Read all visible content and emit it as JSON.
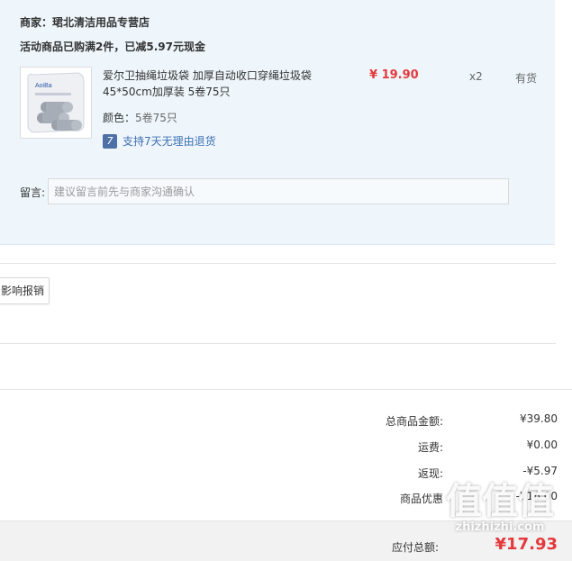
{
  "store": {
    "prefix": "商家：",
    "name": "珺北清洁用品专营店",
    "promotion": "活动商品已购满2件，已减5.97元现金"
  },
  "product": {
    "title": "爱尔卫抽绳垃圾袋 加厚自动收口穿绳垃圾袋45*50cm加厚装 5卷75只",
    "price": "¥ 19.90",
    "quantity": "x2",
    "stock": "有货",
    "spec_label": "颜色：",
    "spec_value": "5卷75只",
    "return_badge": "7",
    "return_policy": "支持7天无理由退货",
    "thumb_text": "AoiBa"
  },
  "message": {
    "label": "留言:",
    "placeholder": "建议留言前先与商家沟通确认"
  },
  "side_button": {
    "label": "影响报销"
  },
  "summary": {
    "rows": [
      {
        "label": "总商品金额:",
        "value": "¥39.80"
      },
      {
        "label": "运费:",
        "value": "¥0.00"
      },
      {
        "label": "返现:",
        "value": "-¥5.97"
      },
      {
        "label": "商品优惠",
        "value": "-¥16.00"
      }
    ],
    "total_label": "应付总额:",
    "total_value": "¥17.93"
  },
  "watermark": {
    "logo": "值值值",
    "text": "zhizhizhi.com"
  },
  "colors": {
    "panel_bg": "#eef6fb",
    "price_red": "#e4393c",
    "link_blue": "#3f6fb5",
    "footer_bg": "#f2f2f2"
  }
}
